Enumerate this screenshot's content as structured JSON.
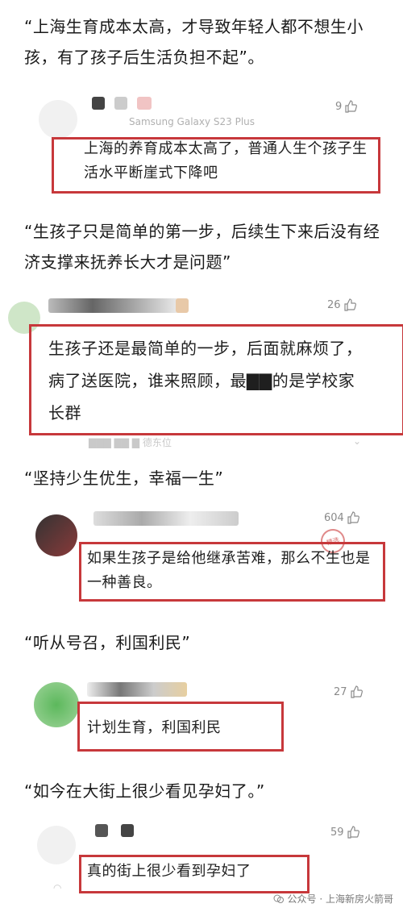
{
  "quotes": [
    "“上海生育成本太高，才导致年轻人都不想生小孩，有了孩子后生活负担不起”。",
    "“生孩子只是简单的第一步，后续生下来后没有经济支撑来抚养长大才是问题”",
    "“坚持少生优生，幸福一生”",
    "“听从号召，利国利民”",
    "“如今在大街上很少看见孕妇了。”"
  ],
  "comments": [
    {
      "likes": "9",
      "device": "Samsung Galaxy S23 Plus",
      "text": "上海的养育成本太高了，普通人生个孩子生活水平断崖式下降吧"
    },
    {
      "likes": "26",
      "text": "生孩子还是最简单的一步，后面就麻烦了，病了送医院，谁来照顾，最▇▇的是学校家长群",
      "footer": "▇▇▇  ▇▇ ▇ 德东位"
    },
    {
      "likes": "604",
      "text": "如果生孩子是给他继承苦难，那么不生也是一种善良。",
      "stamp": "精选"
    },
    {
      "likes": "27",
      "text": "计划生育，利国利民"
    },
    {
      "likes": "59",
      "text": "真的街上很少看到孕妇了"
    }
  ],
  "watermark": {
    "text": "公众号 · 上海新房火箭哥"
  },
  "colors": {
    "highlight_border": "#c7383b",
    "like_gray": "#8a8a8a"
  }
}
